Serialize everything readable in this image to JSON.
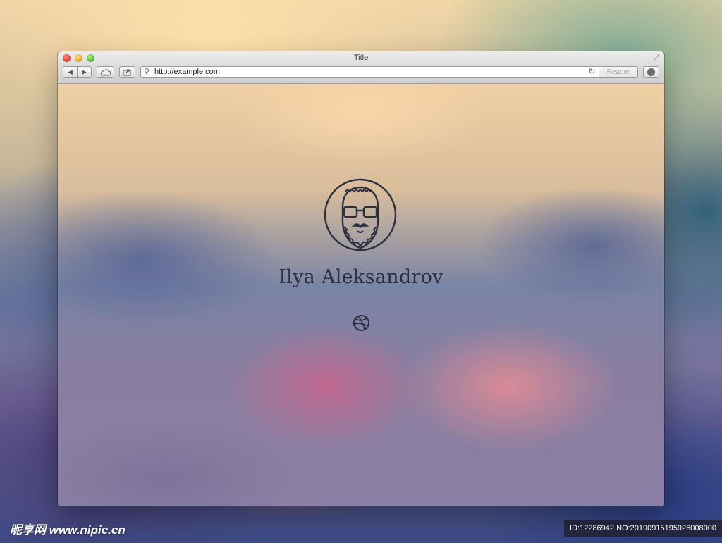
{
  "window": {
    "title": "Title",
    "url": "http://example.com",
    "reader_label": "Reader"
  },
  "icons": {
    "back": "back-arrow-icon",
    "forward": "forward-arrow-icon",
    "cloud": "icloud-tabs-icon",
    "share": "share-icon",
    "site": "link-icon",
    "reload": "reload-icon",
    "download": "download-icon",
    "fullscreen": "fullscreen-icon"
  },
  "profile": {
    "name": "Ilya Aleksandrov",
    "avatar_icon": "bearded-man-avatar-icon",
    "social_icon": "dribbble-icon"
  },
  "watermark": {
    "site": "昵享网 www.nipic.cn",
    "id": "ID:12286942 NO:20190915195926008000"
  },
  "colors": {
    "text_dark": "#2b2f40",
    "close": "#e0443a",
    "minimize": "#e7a92e",
    "maximize": "#5fb83a"
  }
}
